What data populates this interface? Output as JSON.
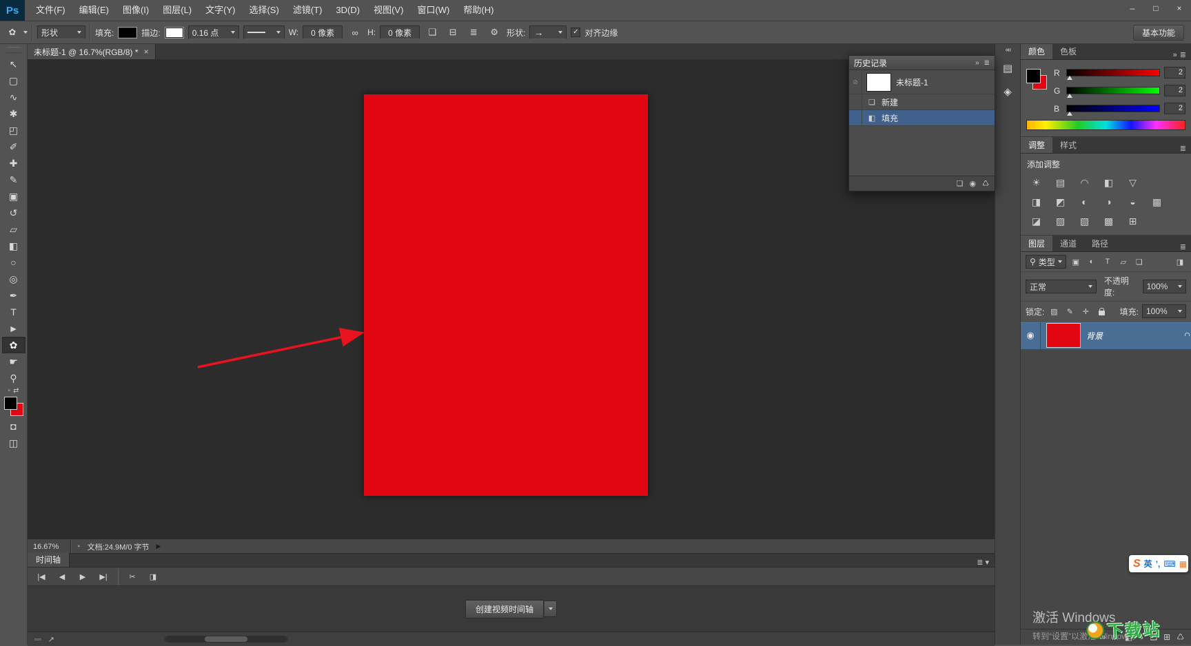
{
  "colors": {
    "document_red": "#e20613",
    "selection_blue": "#44618c",
    "arrow_red": "#e8131d",
    "chrome_gray": "#535353"
  },
  "menu_bar": {
    "logo": "Ps",
    "items": [
      "文件(F)",
      "编辑(E)",
      "图像(I)",
      "图层(L)",
      "文字(Y)",
      "选择(S)",
      "滤镜(T)",
      "3D(D)",
      "视图(V)",
      "窗口(W)",
      "帮助(H)"
    ],
    "window_controls": {
      "minimize": "–",
      "restore": "□",
      "close": "×"
    }
  },
  "options_bar": {
    "tool_preset_icon": "✿",
    "mode": "形状",
    "fill_label": "填充:",
    "stroke_label": "描边:",
    "stroke_width": "0.16 点",
    "w_label": "W:",
    "w_value": "0 像素",
    "link_icon": "∞",
    "h_label": "H:",
    "h_value": "0 像素",
    "path_ops_icon": "❏",
    "path_align_icon": "⊟",
    "path_arrange_icon": "≣",
    "gear_icon": "⚙",
    "shape_label": "形状:",
    "shape_preview_icon": "→",
    "check_icon": "✓",
    "align_edges_label": "对齐边缘",
    "workspace_button": "基本功能"
  },
  "document_tab": {
    "title": "未标题-1 @ 16.7%(RGB/8) *",
    "close_icon": "×"
  },
  "toolbar": {
    "tools": [
      {
        "name": "move-tool",
        "glyph": "↖"
      },
      {
        "name": "rectangular-marquee-tool",
        "glyph": "▢"
      },
      {
        "name": "lasso-tool",
        "glyph": "∿"
      },
      {
        "name": "quick-selection-tool",
        "glyph": "✱"
      },
      {
        "name": "crop-tool",
        "glyph": "◰"
      },
      {
        "name": "eyedropper-tool",
        "glyph": "✐"
      },
      {
        "name": "spot-healing-brush-tool",
        "glyph": "✚"
      },
      {
        "name": "brush-tool",
        "glyph": "✎"
      },
      {
        "name": "clone-stamp-tool",
        "glyph": "▣"
      },
      {
        "name": "history-brush-tool",
        "glyph": "↺"
      },
      {
        "name": "eraser-tool",
        "glyph": "▱"
      },
      {
        "name": "gradient-tool",
        "glyph": "◧"
      },
      {
        "name": "blur-tool",
        "glyph": "○"
      },
      {
        "name": "dodge-tool",
        "glyph": "◎"
      },
      {
        "name": "pen-tool",
        "glyph": "✒"
      },
      {
        "name": "type-tool",
        "glyph": "T"
      },
      {
        "name": "path-selection-tool",
        "glyph": "►"
      },
      {
        "name": "custom-shape-tool",
        "glyph": "✿",
        "selected": true
      },
      {
        "name": "hand-tool",
        "glyph": "☛"
      },
      {
        "name": "zoom-tool",
        "glyph": "⚲"
      }
    ],
    "default_colors_icon": "▫",
    "swap_colors_icon": "⇄",
    "quick_mask_icon": "◘",
    "screen_mode_icon": "◫"
  },
  "history_panel": {
    "title": "历史记录",
    "collapse_icon": "»",
    "menu_icon": "≣",
    "source_icon": "⊘",
    "snapshot": {
      "label": "未标题-1"
    },
    "steps": [
      {
        "icon": "❏",
        "label": "新建",
        "selected": false
      },
      {
        "icon": "◧",
        "label": "填充",
        "selected": true
      }
    ],
    "footer": {
      "new_doc_icon": "❏",
      "snapshot_icon": "◉",
      "trash_icon": "♺"
    }
  },
  "right_strip": {
    "collapse_icon": "««",
    "icon1": "▤",
    "icon2": "◈"
  },
  "color_panel": {
    "tabs": [
      "颜色",
      "色板"
    ],
    "menu_icon": "≣",
    "collapse_icon": "»",
    "channels": [
      {
        "label": "R",
        "value": "2"
      },
      {
        "label": "G",
        "value": "2"
      },
      {
        "label": "B",
        "value": "2"
      }
    ]
  },
  "adjustments_panel": {
    "tabs": [
      "调整",
      "样式"
    ],
    "header": "添加调整",
    "icons": [
      {
        "name": "brightness-contrast-icon",
        "glyph": "☀"
      },
      {
        "name": "levels-icon",
        "glyph": "▤"
      },
      {
        "name": "curves-icon",
        "glyph": "◠"
      },
      {
        "name": "exposure-icon",
        "glyph": "◧"
      },
      {
        "name": "vibrance-icon",
        "glyph": "▽"
      },
      {
        "name": "hue-saturation-icon",
        "glyph": "◨"
      },
      {
        "name": "color-balance-icon",
        "glyph": "◩"
      },
      {
        "name": "black-white-icon",
        "glyph": "◐"
      },
      {
        "name": "photo-filter-icon",
        "glyph": "◑"
      },
      {
        "name": "channel-mixer-icon",
        "glyph": "◒"
      },
      {
        "name": "color-lookup-icon",
        "glyph": "▦"
      },
      {
        "name": "invert-icon",
        "glyph": "◪"
      },
      {
        "name": "posterize-icon",
        "glyph": "▨"
      },
      {
        "name": "threshold-icon",
        "glyph": "▧"
      },
      {
        "name": "gradient-map-icon",
        "glyph": "▩"
      },
      {
        "name": "selective-color-icon",
        "glyph": "⊞"
      }
    ]
  },
  "layers_panel": {
    "tabs": [
      "图层",
      "通道",
      "路径"
    ],
    "menu_icon": "≣",
    "kind_icon": "⚲",
    "kind_label": "类型",
    "filter_icons": [
      {
        "name": "pixel-filter-icon",
        "glyph": "▣"
      },
      {
        "name": "adjustment-filter-icon",
        "glyph": "◐"
      },
      {
        "name": "type-filter-icon",
        "glyph": "T"
      },
      {
        "name": "shape-filter-icon",
        "glyph": "▱"
      },
      {
        "name": "smart-object-filter-icon",
        "glyph": "❏"
      }
    ],
    "filter_toggle_icon": "◨",
    "blend_mode": "正常",
    "opacity_label": "不透明度:",
    "opacity_value": "100%",
    "lock_label": "锁定:",
    "lock_icons": [
      {
        "name": "lock-transparency-icon",
        "glyph": "▨"
      },
      {
        "name": "lock-pixels-icon",
        "glyph": "✎"
      },
      {
        "name": "lock-position-icon",
        "glyph": "✛"
      }
    ],
    "fill_label": "填充:",
    "fill_value": "100%",
    "layer": {
      "name": "背景",
      "eye_icon": "◉"
    },
    "footer_icons": [
      {
        "name": "link-layers-icon",
        "glyph": "∞"
      },
      {
        "name": "layer-style-icon",
        "glyph": "fx"
      },
      {
        "name": "layer-mask-icon",
        "glyph": "◧"
      },
      {
        "name": "adjustment-layer-icon",
        "glyph": "◑"
      },
      {
        "name": "layer-group-icon",
        "glyph": "❏"
      },
      {
        "name": "new-layer-icon",
        "glyph": "⊞"
      },
      {
        "name": "delete-layer-icon",
        "glyph": "♺"
      }
    ]
  },
  "status_bar": {
    "zoom": "16.67%",
    "status_icon": "◔",
    "doc_info": "文档:24.9M/0 字节",
    "expand_icon": "▶"
  },
  "timeline": {
    "tab": "时间轴",
    "menu_icon": "≣",
    "menu_arrow": "▾",
    "transport": [
      {
        "name": "first-frame-button",
        "glyph": "|◀"
      },
      {
        "name": "prev-frame-button",
        "glyph": "◀"
      },
      {
        "name": "play-button",
        "glyph": "▶"
      },
      {
        "name": "next-frame-button",
        "glyph": "▶|"
      }
    ],
    "scissors_icon": "✂",
    "transition_icon": "◨",
    "create_button": "创建视频时间轴",
    "dropdown_icon": "▾",
    "footer": {
      "frames_icon": "▫▫▫",
      "export_icon": "↗"
    }
  },
  "overlays": {
    "ime": {
      "logo": "S",
      "lang": "英",
      "punct": "’,",
      "keyboard_icon": "⌨",
      "toolbox_icon": "▦"
    },
    "activation_line1": "激活 Windows",
    "activation_line2": "转到“设置”以激活 Windows。",
    "watermark_text": "下载站"
  }
}
